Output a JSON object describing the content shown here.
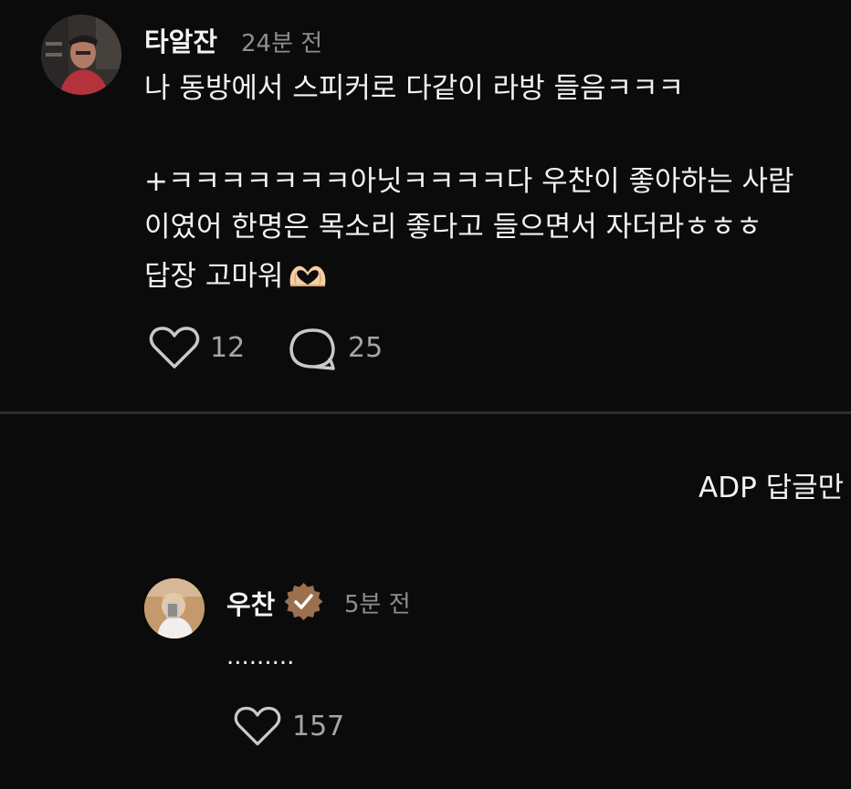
{
  "comment": {
    "author": "타알잔",
    "time": "24분 전",
    "lines": [
      "나 동방에서 스피커로 다같이 라방 들음ㅋㅋㅋ",
      "+ㅋㅋㅋㅋㅋㅋㅋ아닛ㅋㅋㅋㅋ다 우찬이 좋아하는 사람",
      "이였어 한명은 목소리 좋다고 들으면서  자더라ㅎㅎㅎ",
      "답장 고마워"
    ],
    "emoji": "heart-hands-emoji",
    "likes": "12",
    "replies": "25"
  },
  "adp_label": "ADP 답글만",
  "reply": {
    "author": "우찬",
    "verified_icon": "verified-badge-icon",
    "time": "5분 전",
    "text": ".........",
    "likes": "157"
  },
  "colors": {
    "background": "#0c0b0b",
    "text": "#f2f2f2",
    "muted": "#8e8e8e",
    "verified": "#9a7050"
  }
}
